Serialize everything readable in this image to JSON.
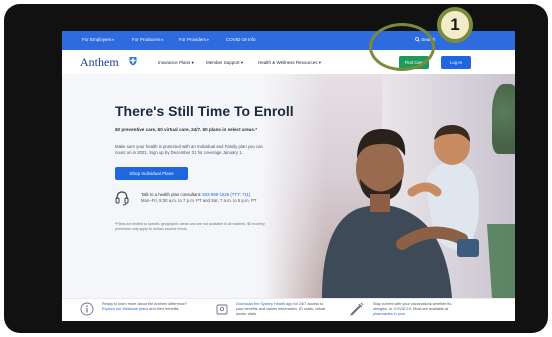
{
  "utility_bar": {
    "items": [
      "For Employers",
      "For Producers",
      "For Providers",
      "COVID-19 Info"
    ],
    "search_label": "Search"
  },
  "main_nav": {
    "logo": "Anthem",
    "items": [
      "Insurance Plans",
      "Member Support",
      "Health & Wellness Resources"
    ],
    "find_care_label": "Find Care",
    "login_label": "Log In"
  },
  "hero": {
    "title": "There's Still Time To Enroll",
    "subtitle": "$0 preventive care, $0 virtual care, 24/7. $0 plans in select areas.*",
    "body": "Make sure your health is protected with an Individual and Family plan you can count on in 2021. Sign up by December 31 for coverage January 1.",
    "shop_button_label": "Shop Individual Plans",
    "talk_text": "Talk to a health plan consultant: ",
    "talk_phone": "833-959-1526 (TTY: 711)",
    "talk_hours": "Mon–Fri, 5:30 a.m. to 7 p.m. PT and Sat, 7 a.m. to 5 p.m. PT",
    "footnote": "*Plans are limited to specific geographic areas and are not available in all markets. $0 monthly premiums only apply to certain income levels."
  },
  "bottom": {
    "col1_pre": "Ready to learn more about the Anthem difference? ",
    "col1_link": "Explore our Medicare plans",
    "col1_post": " and their benefits.",
    "col2_link": "Download the Sydney Health app",
    "col2_post": " for 24/7 access to your benefits and claims information, ID cards, virtual doctor visits.",
    "col3_pre": "Stay current with your vaccinations whether flu, shingles, or COVID-19. Most are available at ",
    "col3_link": "pharmacies in your"
  },
  "callout": {
    "number": "1"
  },
  "colors": {
    "utility_bar": "#2f6be0",
    "find_care": "#1e9a5a",
    "primary_button": "#1f66e0",
    "callout_ring": "#7a8b3b",
    "callout_fill": "#f2ecc9"
  }
}
